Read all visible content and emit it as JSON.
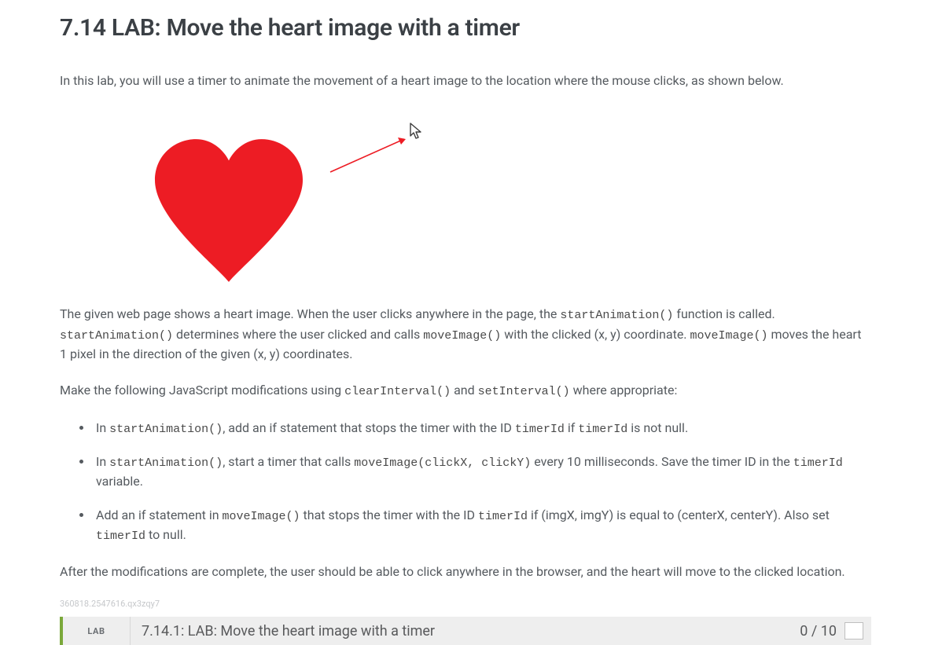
{
  "title": "7.14 LAB: Move the heart image with a timer",
  "intro": "In this lab, you will use a timer to animate the movement of a heart image to the location where the mouse clicks, as shown below.",
  "para2": {
    "t1": "The given web page shows a heart image. When the user clicks anywhere in the page, the ",
    "c1": "startAnimation()",
    "t2": " function is called. ",
    "c2": "startAnimation()",
    "t3": " determines where the user clicked and calls ",
    "c3": "moveImage()",
    "t4": " with the clicked (x, y) coordinate. ",
    "c4": "moveImage()",
    "t5": " moves the heart 1 pixel in the direction of the given (x, y) coordinates."
  },
  "para3": {
    "t1": "Make the following JavaScript modifications using ",
    "c1": "clearInterval()",
    "t2": " and ",
    "c2": "setInterval()",
    "t3": " where appropriate:"
  },
  "bullets": {
    "b1": {
      "t1": "In ",
      "c1": "startAnimation()",
      "t2": ", add an if statement that stops the timer with the ID ",
      "c2": "timerId",
      "t3": " if ",
      "c3": "timerId",
      "t4": " is not null."
    },
    "b2": {
      "t1": "In ",
      "c1": "startAnimation()",
      "t2": ", start a timer that calls ",
      "c2": "moveImage(clickX, clickY)",
      "t3": " every 10 milliseconds. Save the timer ID in the ",
      "c3": "timerId",
      "t4": " variable."
    },
    "b3": {
      "t1": "Add an if statement in ",
      "c1": "moveImage()",
      "t2": " that stops the timer with the ID ",
      "c2": "timerId",
      "t3": " if (imgX, imgY) is equal to (centerX, centerY). Also set ",
      "c3": "timerId",
      "t4": " to null."
    }
  },
  "closing": "After the modifications are complete, the user should be able to click anywhere in the browser, and the heart will move to the clicked location.",
  "watermark": "360818.2547616.qx3zqy7",
  "activity": {
    "tag": "LAB",
    "title": "7.14.1: LAB: Move the heart image with a timer",
    "score": "0 / 10"
  }
}
